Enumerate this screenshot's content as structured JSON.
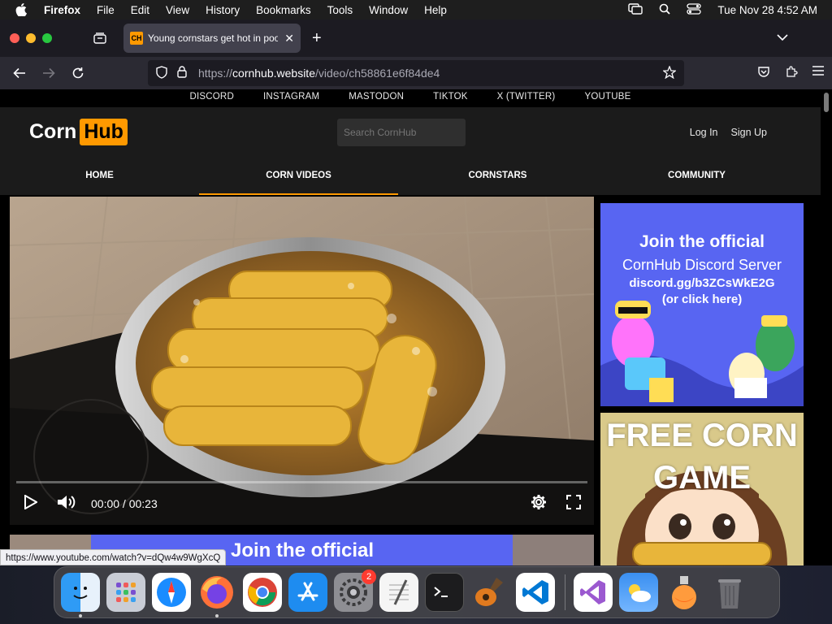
{
  "menubar": {
    "app_name": "Firefox",
    "items": [
      "File",
      "Edit",
      "View",
      "History",
      "Bookmarks",
      "Tools",
      "Window",
      "Help"
    ],
    "clock": "Tue Nov 28  4:52 AM"
  },
  "browser": {
    "tab": {
      "favicon": "CH",
      "title": "Young cornstars get hot in pool"
    },
    "url": {
      "scheme": "https://",
      "host": "cornhub.website",
      "path": "/video/ch58861e6f84de4"
    },
    "status_url": "https://www.youtube.com/watch?v=dQw4w9WgXcQ"
  },
  "site": {
    "social_links": [
      "DISCORD",
      "INSTAGRAM",
      "MASTODON",
      "TIKTOK",
      "X (TWITTER)",
      "YOUTUBE"
    ],
    "logo_left": "Corn",
    "logo_right": "Hub",
    "search_placeholder": "Search CornHub",
    "login_label": "Log In",
    "signup_label": "Sign Up",
    "nav": [
      {
        "label": "HOME",
        "active": false
      },
      {
        "label": "CORN VIDEOS",
        "active": true
      },
      {
        "label": "CORNSTARS",
        "active": false
      },
      {
        "label": "COMMUNITY",
        "active": false
      }
    ],
    "accent_color": "#ff9900"
  },
  "video": {
    "time": "00:00 / 00:23",
    "progress": 0
  },
  "ads": {
    "discord": {
      "line1": "Join the official",
      "line2": "CornHub Discord Server",
      "line3": "discord.gg/b3ZCsWkE2G",
      "line4": "(or click here)"
    },
    "game": {
      "line1": "FREE CORN",
      "line2": "GAME"
    },
    "banner": {
      "text": "Join the official"
    }
  },
  "dock": {
    "apps": [
      "Finder",
      "Launchpad",
      "Safari",
      "Firefox",
      "Chrome",
      "App Store",
      "System Settings",
      "TextEdit",
      "Terminal",
      "GarageBand",
      "Visual Studio Code",
      "Visual Studio",
      "Weather",
      "Potion",
      "Trash"
    ],
    "settings_badge": "2"
  }
}
